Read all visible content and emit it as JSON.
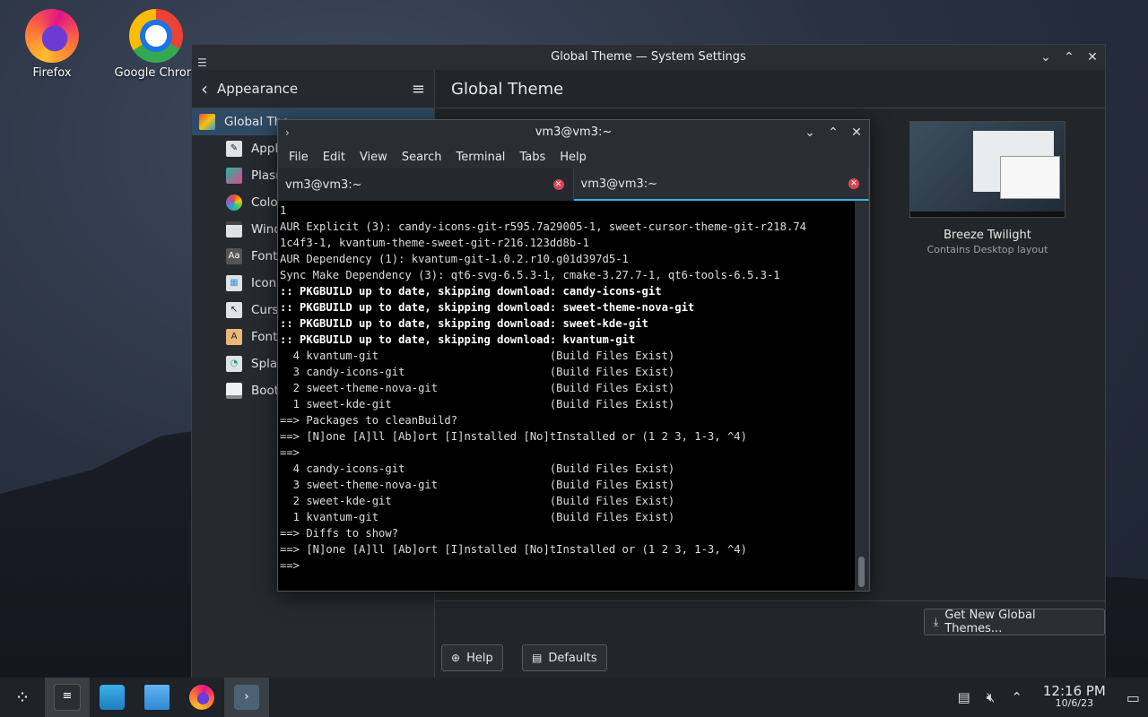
{
  "desktop": {
    "icons": [
      {
        "label": "Firefox"
      },
      {
        "label": "Google Chrom"
      }
    ]
  },
  "settings": {
    "window_title": "Global Theme — System Settings",
    "sidebar_title": "Appearance",
    "sidebar_items": [
      {
        "label": "Global The",
        "icon": "global-theme-icon"
      },
      {
        "label": "Appl",
        "icon": "application-style-icon"
      },
      {
        "label": "Plasn",
        "icon": "plasma-style-icon"
      },
      {
        "label": "Colo",
        "icon": "colors-icon"
      },
      {
        "label": "Wind",
        "icon": "window-decorations-icon"
      },
      {
        "label": "Font",
        "icon": "fonts-icon"
      },
      {
        "label": "Icon",
        "icon": "icons-icon"
      },
      {
        "label": "Curs",
        "icon": "cursors-icon"
      },
      {
        "label": "Font",
        "icon": "font-management-icon"
      },
      {
        "label": "Splas",
        "icon": "splash-screen-icon"
      },
      {
        "label": "Boot",
        "icon": "boot-splash-icon"
      }
    ],
    "page_title": "Global Theme",
    "theme_card": {
      "name": "Breeze Twilight",
      "desc": "Contains Desktop layout"
    },
    "get_new_label": "Get New Global Themes...",
    "help_label": "Help",
    "defaults_label": "Defaults"
  },
  "terminal": {
    "window_title": "vm3@vm3:~",
    "menu": [
      "File",
      "Edit",
      "View",
      "Search",
      "Terminal",
      "Tabs",
      "Help"
    ],
    "tabs": [
      {
        "label": "vm3@vm3:~"
      },
      {
        "label": "vm3@vm3:~"
      }
    ],
    "lines": [
      {
        "text": "1",
        "bold": false
      },
      {
        "text": "AUR Explicit (3): candy-icons-git-r595.7a29005-1, sweet-cursor-theme-git-r218.74",
        "bold": false
      },
      {
        "text": "1c4f3-1, kvantum-theme-sweet-git-r216.123dd8b-1",
        "bold": false
      },
      {
        "text": "AUR Dependency (1): kvantum-git-1.0.2.r10.g01d397d5-1",
        "bold": false
      },
      {
        "text": "Sync Make Dependency (3): qt6-svg-6.5.3-1, cmake-3.27.7-1, qt6-tools-6.5.3-1",
        "bold": false
      },
      {
        "text": ":: PKGBUILD up to date, skipping download: candy-icons-git",
        "bold": true
      },
      {
        "text": ":: PKGBUILD up to date, skipping download: sweet-theme-nova-git",
        "bold": true
      },
      {
        "text": ":: PKGBUILD up to date, skipping download: sweet-kde-git",
        "bold": true
      },
      {
        "text": ":: PKGBUILD up to date, skipping download: kvantum-git",
        "bold": true
      },
      {
        "text": "  4 kvantum-git                          (Build Files Exist)",
        "bold": false
      },
      {
        "text": "  3 candy-icons-git                      (Build Files Exist)",
        "bold": false
      },
      {
        "text": "  2 sweet-theme-nova-git                 (Build Files Exist)",
        "bold": false
      },
      {
        "text": "  1 sweet-kde-git                        (Build Files Exist)",
        "bold": false
      },
      {
        "text": "==> Packages to cleanBuild?",
        "bold": false
      },
      {
        "text": "==> [N]one [A]ll [Ab]ort [I]nstalled [No]tInstalled or (1 2 3, 1-3, ^4)",
        "bold": false
      },
      {
        "text": "==>",
        "bold": false
      },
      {
        "text": "  4 candy-icons-git                      (Build Files Exist)",
        "bold": false
      },
      {
        "text": "  3 sweet-theme-nova-git                 (Build Files Exist)",
        "bold": false
      },
      {
        "text": "  2 sweet-kde-git                        (Build Files Exist)",
        "bold": false
      },
      {
        "text": "  1 kvantum-git                          (Build Files Exist)",
        "bold": false
      },
      {
        "text": "==> Diffs to show?",
        "bold": false
      },
      {
        "text": "==> [N]one [A]ll [Ab]ort [I]nstalled [No]tInstalled or (1 2 3, 1-3, ^4)",
        "bold": false
      },
      {
        "text": "==>",
        "bold": false
      }
    ]
  },
  "taskbar": {
    "clock_time": "12:16 PM",
    "clock_date": "10/6/23"
  },
  "colors": {
    "accent": "#3daee9",
    "close_tab": "#da4453"
  }
}
